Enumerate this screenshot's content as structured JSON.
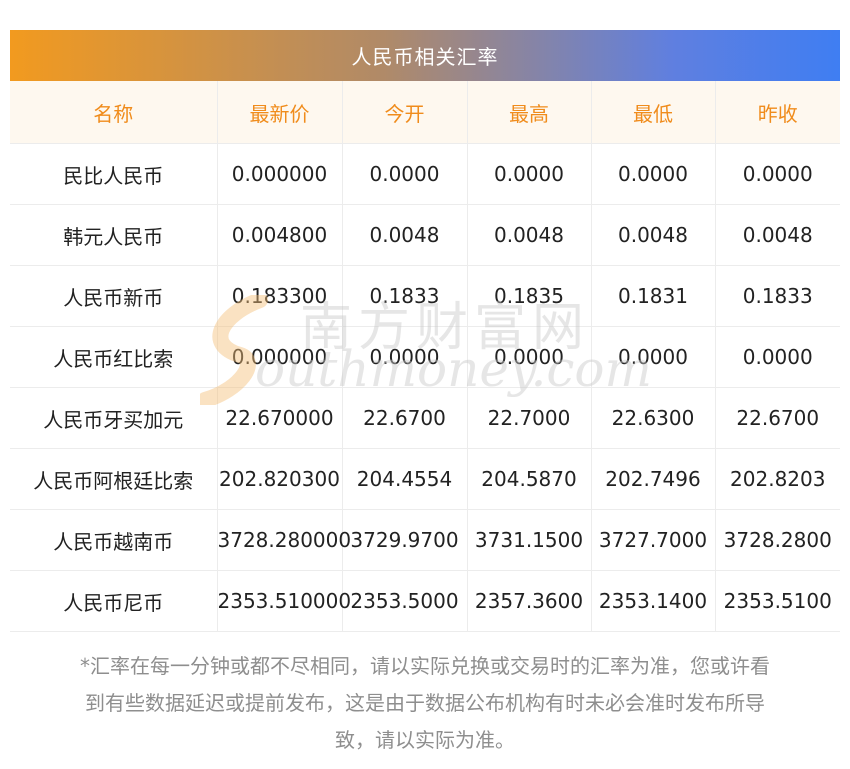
{
  "title": "人民币相关汇率",
  "headers": [
    "名称",
    "最新价",
    "今开",
    "最高",
    "最低",
    "昨收"
  ],
  "rows": [
    [
      "民比人民币",
      "0.000000",
      "0.0000",
      "0.0000",
      "0.0000",
      "0.0000"
    ],
    [
      "韩元人民币",
      "0.004800",
      "0.0048",
      "0.0048",
      "0.0048",
      "0.0048"
    ],
    [
      "人民币新币",
      "0.183300",
      "0.1833",
      "0.1835",
      "0.1831",
      "0.1833"
    ],
    [
      "人民币红比索",
      "0.000000",
      "0.0000",
      "0.0000",
      "0.0000",
      "0.0000"
    ],
    [
      "人民币牙买加元",
      "22.670000",
      "22.6700",
      "22.7000",
      "22.6300",
      "22.6700"
    ],
    [
      "人民币阿根廷比索",
      "202.820300",
      "204.4554",
      "204.5870",
      "202.7496",
      "202.8203"
    ],
    [
      "人民币越南币",
      "3728.280000",
      "3729.9700",
      "3731.1500",
      "3727.7000",
      "3728.2800"
    ],
    [
      "人民币尼币",
      "2353.510000",
      "2353.5000",
      "2357.3600",
      "2353.1400",
      "2353.5100"
    ]
  ],
  "watermark": {
    "cn": "南方财富网",
    "en": "outhmoney.com"
  },
  "note_lines": [
    "*汇率在每一分钟或都不尽相同，请以实际兑换或交易时的汇率为准，您或许看",
    "到有些数据延迟或提前发布，这是由于数据公布机构有时未必会准时发布所导",
    "致，请以实际为准。"
  ],
  "colors": {
    "header_text": "#f08c1c",
    "title_gradient_start": "#f29a1f",
    "title_gradient_end": "#3f7ef2"
  }
}
